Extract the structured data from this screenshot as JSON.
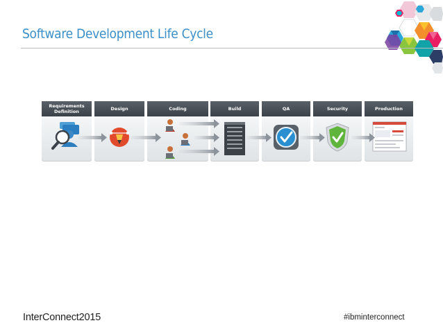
{
  "title": "Software Development Life Cycle",
  "stages": [
    {
      "line1": "Requirements",
      "line2": "Definition",
      "icon": "magnifier-person-icon"
    },
    {
      "line1": "Design",
      "line2": "",
      "icon": "pen-nib-icon"
    },
    {
      "line1": "Coding",
      "line2": "",
      "icon": "developers-icon"
    },
    {
      "line1": "Build",
      "line2": "",
      "icon": "server-icon"
    },
    {
      "line1": "QA",
      "line2": "",
      "icon": "check-circle-icon"
    },
    {
      "line1": "Security",
      "line2": "",
      "icon": "check-shield-icon"
    },
    {
      "line1": "Production",
      "line2": "",
      "icon": "web-page-icon"
    }
  ],
  "footer": {
    "brand": "InterConnect",
    "year": "2015",
    "hashtag": "#ibminterconnect"
  },
  "colors": {
    "title": "#3a8fc8",
    "header": "#4a5058",
    "qa": "#2a8fd0",
    "security": "#5fb43c",
    "design": "#e24a2e"
  }
}
